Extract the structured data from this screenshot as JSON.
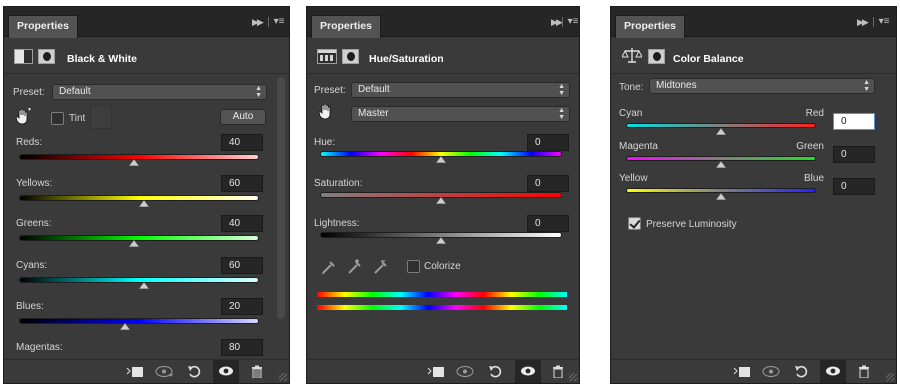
{
  "panels": [
    {
      "tab_label": "Properties",
      "title": "Black & White",
      "preset_label": "Preset:",
      "preset_value": "Default",
      "tint_label": "Tint",
      "auto_label": "Auto",
      "sliders": [
        {
          "label": "Reds:",
          "value": "40"
        },
        {
          "label": "Yellows:",
          "value": "60"
        },
        {
          "label": "Greens:",
          "value": "40"
        },
        {
          "label": "Cyans:",
          "value": "60"
        },
        {
          "label": "Blues:",
          "value": "20"
        },
        {
          "label": "Magentas:",
          "value": "80"
        }
      ]
    },
    {
      "tab_label": "Properties",
      "title": "Hue/Saturation",
      "preset_label": "Preset:",
      "preset_value": "Default",
      "channel_value": "Master",
      "sliders": [
        {
          "label": "Hue:",
          "value": "0"
        },
        {
          "label": "Saturation:",
          "value": "0"
        },
        {
          "label": "Lightness:",
          "value": "0"
        }
      ],
      "colorize_label": "Colorize"
    },
    {
      "tab_label": "Properties",
      "title": "Color Balance",
      "tone_label": "Tone:",
      "tone_value": "Midtones",
      "sliders": [
        {
          "left": "Cyan",
          "right": "Red",
          "value": "0"
        },
        {
          "left": "Magenta",
          "right": "Green",
          "value": "0"
        },
        {
          "left": "Yellow",
          "right": "Blue",
          "value": "0"
        }
      ],
      "preserve_label": "Preserve Luminosity"
    }
  ],
  "slider_levels": {
    "bw": [
      0.48,
      0.52,
      0.48,
      0.52,
      0.44,
      0.56
    ],
    "hue_sat": [
      0.5,
      0.5,
      0.5
    ],
    "color_balance": [
      0.5,
      0.5,
      0.5
    ]
  },
  "icons": {
    "collapse": "double-arrow-right-icon",
    "menu": "panel-menu-icon",
    "hand": "targeted-adjustment-hand-icon",
    "clip": "clip-to-layer-icon",
    "view_previous": "view-previous-state-icon",
    "reset": "reset-icon",
    "visibility": "eye-icon",
    "delete": "trash-icon"
  },
  "colors": {
    "panel_bg": "#3a3a3a",
    "titlebar_bg": "#262626",
    "accent_focus": "#5b8fd4"
  }
}
